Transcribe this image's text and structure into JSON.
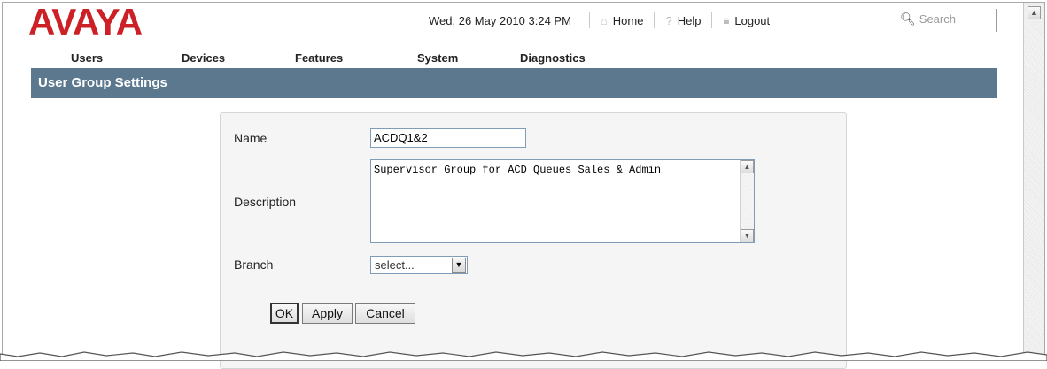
{
  "brand": {
    "logo_text": "AVAYA",
    "logo_color": "#cc1f26"
  },
  "header": {
    "datetime": "Wed, 26 May 2010 3:24 PM",
    "home_label": "Home",
    "help_label": "Help",
    "logout_label": "Logout",
    "search_placeholder": "Search"
  },
  "nav": {
    "items": [
      {
        "label": "Users"
      },
      {
        "label": "Devices"
      },
      {
        "label": "Features"
      },
      {
        "label": "System"
      },
      {
        "label": "Diagnostics"
      }
    ]
  },
  "page": {
    "title": "User Group Settings",
    "title_bar_color": "#5b788f"
  },
  "form": {
    "name_label": "Name",
    "name_value": "ACDQ1&2",
    "description_label": "Description",
    "description_value": "Supervisor Group for ACD Queues Sales & Admin",
    "branch_label": "Branch",
    "branch_selected": "select..."
  },
  "buttons": {
    "ok": "OK",
    "apply": "Apply",
    "cancel": "Cancel"
  }
}
